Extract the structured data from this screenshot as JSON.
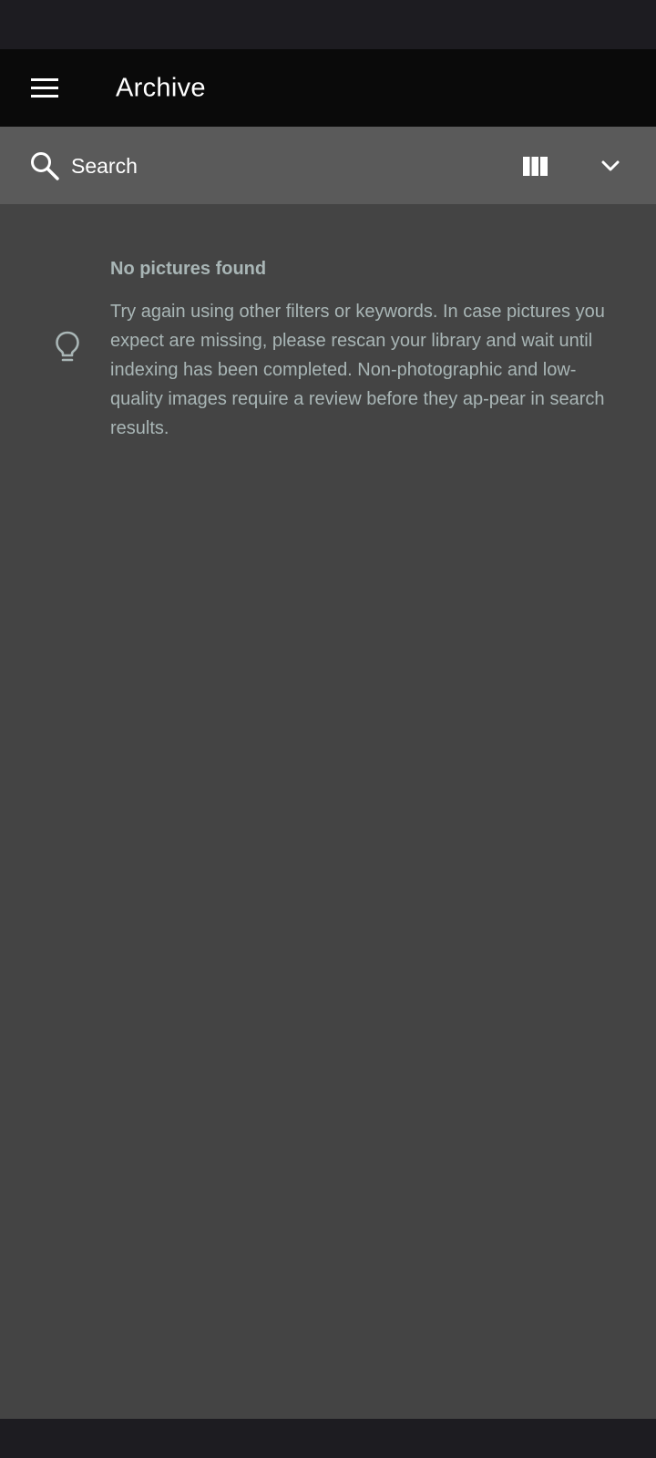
{
  "app_bar": {
    "title": "Archive",
    "menu_icon": "menu-icon"
  },
  "search": {
    "placeholder": "Search",
    "value": "",
    "search_icon": "search-icon",
    "view_icon": "view-column-icon",
    "expand_icon": "chevron-down-icon"
  },
  "empty_state": {
    "icon": "lightbulb-icon",
    "title": "No pictures found",
    "message": "Try again using other filters or keywords. In case pictures you expect are missing, please rescan your library and wait until indexing has been completed. Non-photographic and low-quality images require a review before they ap-pear in search results."
  },
  "colors": {
    "status_bar": "#1d1c21",
    "app_bar": "#0a0a0a",
    "search_bar": "#5a5a5a",
    "content_bg": "#444444",
    "message_text": "#a9b6b6"
  }
}
